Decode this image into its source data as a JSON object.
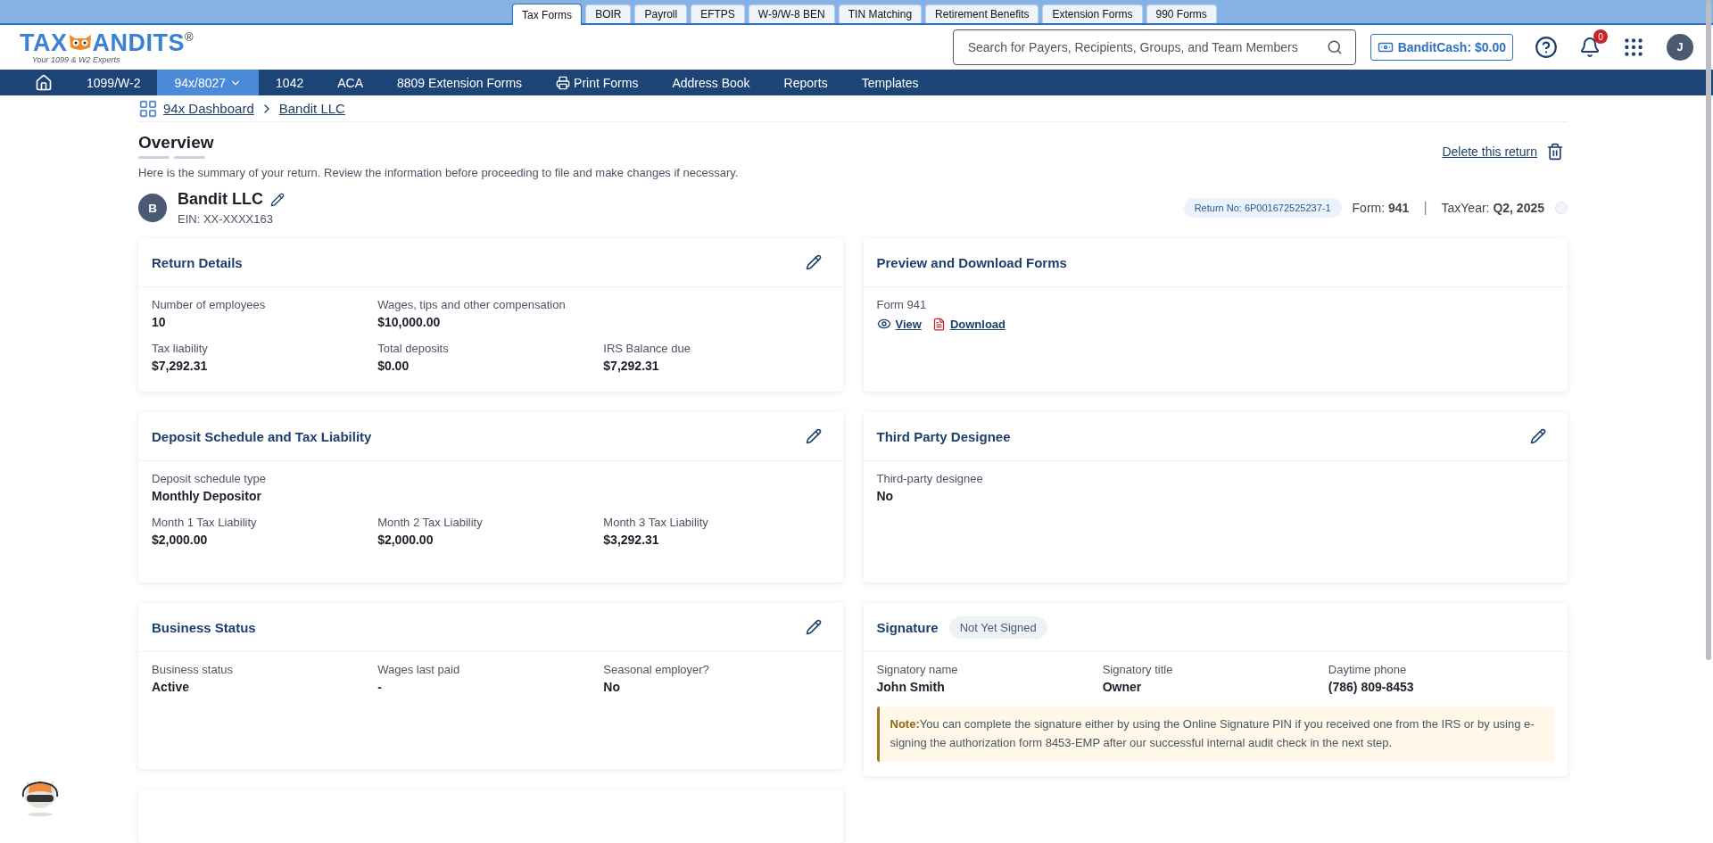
{
  "top_tabs": [
    {
      "label": "Tax Forms",
      "selected": true
    },
    {
      "label": "BOIR",
      "selected": false
    },
    {
      "label": "Payroll",
      "selected": false
    },
    {
      "label": "EFTPS",
      "selected": false
    },
    {
      "label": "W-9/W-8 BEN",
      "selected": false
    },
    {
      "label": "TIN Matching",
      "selected": false
    },
    {
      "label": "Retirement Benefits",
      "selected": false
    },
    {
      "label": "Extension Forms",
      "selected": false
    },
    {
      "label": "990 Forms",
      "selected": false
    }
  ],
  "logo": {
    "left": "TAX",
    "right": "ANDITS",
    "mark": "®",
    "tagline": "Your 1099 & W2 Experts"
  },
  "search": {
    "placeholder": "Search for Payers, Recipients, Groups, and Team Members"
  },
  "bandit_cash": "BanditCash: $0.00",
  "notifications": {
    "count": "0"
  },
  "user": {
    "initial": "J"
  },
  "nav": [
    {
      "kind": "home",
      "selected": false
    },
    {
      "kind": "text",
      "label": "1099/W-2",
      "selected": false
    },
    {
      "kind": "dropdown",
      "label": "94x/8027",
      "selected": true
    },
    {
      "kind": "text",
      "label": "1042",
      "selected": false
    },
    {
      "kind": "text",
      "label": "ACA",
      "selected": false
    },
    {
      "kind": "text",
      "label": "8809 Extension Forms",
      "selected": false
    },
    {
      "kind": "print",
      "label": "Print Forms",
      "selected": false
    },
    {
      "kind": "text",
      "label": "Address Book",
      "selected": false
    },
    {
      "kind": "text",
      "label": "Reports",
      "selected": false
    },
    {
      "kind": "text",
      "label": "Templates",
      "selected": false
    }
  ],
  "breadcrumb": [
    "94x Dashboard",
    "Bandit LLC"
  ],
  "overview": {
    "title": "Overview",
    "description": "Here is the summary of your return. Review the information before proceeding to file and make changes if necessary.",
    "delete": "Delete this return"
  },
  "company": {
    "initial": "B",
    "name": "Bandit LLC",
    "ein": "EIN: XX-XXXX163",
    "return_no": "Return No: 6P001672525237-1",
    "form_label": "Form:",
    "form": "941",
    "separator": "|",
    "year_label": "TaxYear:",
    "year": "Q2, 2025"
  },
  "left_cards": [
    {
      "title": "Return Details",
      "editable": true,
      "rows": [
        [
          {
            "label": "Number of employees",
            "value": "10"
          },
          {
            "label": "Wages, tips and other compensation",
            "value": "$10,000.00"
          }
        ],
        [
          {
            "label": "Tax liability",
            "value": "$7,292.31"
          },
          {
            "label": "Total deposits",
            "value": "$0.00"
          },
          {
            "label": "IRS Balance due",
            "value": "$7,292.31"
          }
        ]
      ]
    },
    {
      "title": "Deposit Schedule and Tax Liability",
      "editable": true,
      "rows": [
        [
          {
            "label": "Deposit schedule type",
            "value": "Monthly Depositor"
          }
        ],
        [
          {
            "label": "Month 1 Tax Liability",
            "value": "$2,000.00"
          },
          {
            "label": "Month 2 Tax Liability",
            "value": "$2,000.00"
          },
          {
            "label": "Month 3 Tax Liability",
            "value": "$3,292.31"
          }
        ]
      ]
    },
    {
      "title": "Business Status",
      "editable": true,
      "rows": [
        [
          {
            "label": "Business status",
            "value": "Active"
          },
          {
            "label": "Wages last paid",
            "value": "-"
          },
          {
            "label": "Seasonal employer?",
            "value": "No"
          }
        ]
      ]
    }
  ],
  "right_cards": [
    {
      "title": "Preview and Download Forms",
      "editable": false,
      "form_label": "Form 941",
      "links": [
        {
          "kind": "view",
          "label": "View"
        },
        {
          "kind": "download",
          "label": "Download"
        }
      ]
    },
    {
      "title": "Third Party Designee",
      "editable": true,
      "rows": [
        [
          {
            "label": "Third-party designee",
            "value": "No"
          }
        ]
      ]
    },
    {
      "title": "Signature",
      "editable": false,
      "badge": "Not Yet Signed",
      "rows": [
        [
          {
            "label": "Signatory name",
            "value": "John Smith"
          },
          {
            "label": "Signatory title",
            "value": "Owner"
          },
          {
            "label": "Daytime phone",
            "value": "(786) 809-8453"
          }
        ]
      ],
      "note": {
        "label": "Note:",
        "text": "You can complete the signature either by using the Online Signature PIN if you received one from the IRS or by using e-signing the authorization form 8453-EMP after our successful internal audit check in the next step."
      }
    }
  ]
}
